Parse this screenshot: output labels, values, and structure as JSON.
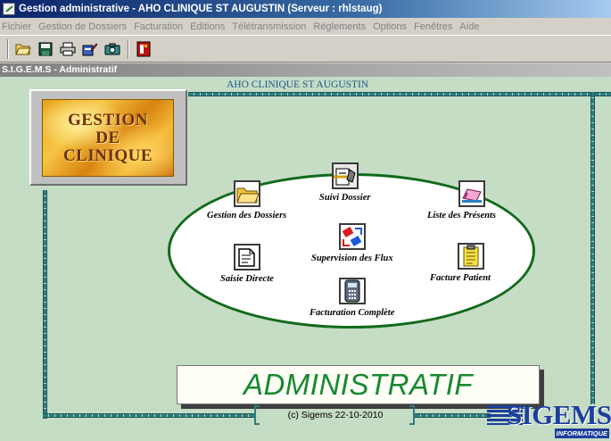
{
  "window": {
    "title": "Gestion administrative  -  AHO CLINIQUE ST AUGUSTIN (Serveur : rhlstaug)"
  },
  "menu": [
    {
      "label": "Fichier"
    },
    {
      "label": "Gestion de Dossiers"
    },
    {
      "label": "Facturation"
    },
    {
      "label": "Editions"
    },
    {
      "label": "Télétransmission"
    },
    {
      "label": "Réglements"
    },
    {
      "label": "Options"
    },
    {
      "label": "Fenêtres"
    },
    {
      "label": "Aide"
    }
  ],
  "toolbar": {
    "icons": [
      "open-folder-icon",
      "save-icon",
      "print-icon",
      "edit-document-icon",
      "camera-icon",
      "exit-door-icon"
    ]
  },
  "child_window": {
    "title": "S.I.G.E.M.S - Administratif"
  },
  "main": {
    "clinic_name": "AHO CLINIQUE ST AUGUSTIN",
    "logo_lines": [
      "GESTION",
      "DE",
      "CLINIQUE"
    ],
    "modules": [
      {
        "label": "Gestion des Dossiers",
        "icon": "folder-icon"
      },
      {
        "label": "Suivi Dossier",
        "icon": "tracking-icon"
      },
      {
        "label": "Liste des Présents",
        "icon": "bed-list-icon"
      },
      {
        "label": "Supervision des Flux",
        "icon": "flux-arrows-icon"
      },
      {
        "label": "Saisie Directe",
        "icon": "direct-entry-icon"
      },
      {
        "label": "Facture Patient",
        "icon": "clipboard-icon"
      },
      {
        "label": "Facturation Complète",
        "icon": "calculator-icon"
      }
    ],
    "banner": "ADMINISTRATIF",
    "copyright": "(c) Sigems 22-10-2010",
    "brand": {
      "name": "SIGEMS",
      "sub": "INFORMATIQUE"
    }
  },
  "colors": {
    "titlebar": "#0a246a",
    "frame_teal": "#2f7d7d",
    "background_green": "#c5dcc5",
    "ellipse_border": "#116a1a",
    "banner_text": "#168a2e",
    "brand_blue": "#1d3f9c"
  }
}
